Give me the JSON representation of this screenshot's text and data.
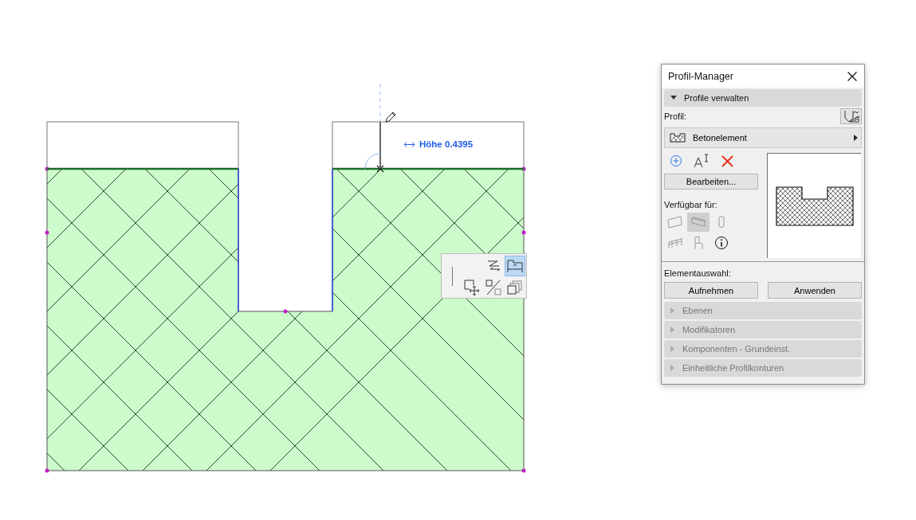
{
  "canvas": {
    "dimension_tooltip": "Höhe 0.4395",
    "pet_palette": [
      {
        "kind": "offset",
        "selected": false
      },
      {
        "kind": "edge",
        "selected": true
      },
      {
        "kind": "move",
        "selected": false
      },
      {
        "kind": "split",
        "selected": false
      },
      {
        "kind": "copy",
        "selected": false
      }
    ]
  },
  "dialog": {
    "title": "Profil-Manager",
    "manage_section": {
      "label": "Profile verwalten",
      "expanded": true
    },
    "profile_label": "Profil:",
    "profile_select": "Betonelement",
    "edit_button": "Bearbeiten...",
    "available_label": "Verfügbar für:",
    "available_for": [
      {
        "kind": "wall",
        "selected": false,
        "disabled": true
      },
      {
        "kind": "beam",
        "selected": true,
        "disabled": true
      },
      {
        "kind": "column",
        "selected": false,
        "disabled": true
      },
      {
        "kind": "railing",
        "selected": false,
        "disabled": true
      },
      {
        "kind": "object",
        "selected": false,
        "disabled": true
      },
      {
        "kind": "info",
        "selected": false,
        "disabled": false
      }
    ],
    "selection_label": "Elementauswahl:",
    "selection_buttons": [
      "Aufnehmen",
      "Anwenden"
    ],
    "sections": [
      {
        "label": "Ebenen",
        "expanded": false
      },
      {
        "label": "Modifikatoren",
        "expanded": false
      },
      {
        "label": "Komponenten - Grundeinst.",
        "expanded": false
      },
      {
        "label": "Einheitliche Profilkonturen",
        "expanded": false
      }
    ]
  }
}
